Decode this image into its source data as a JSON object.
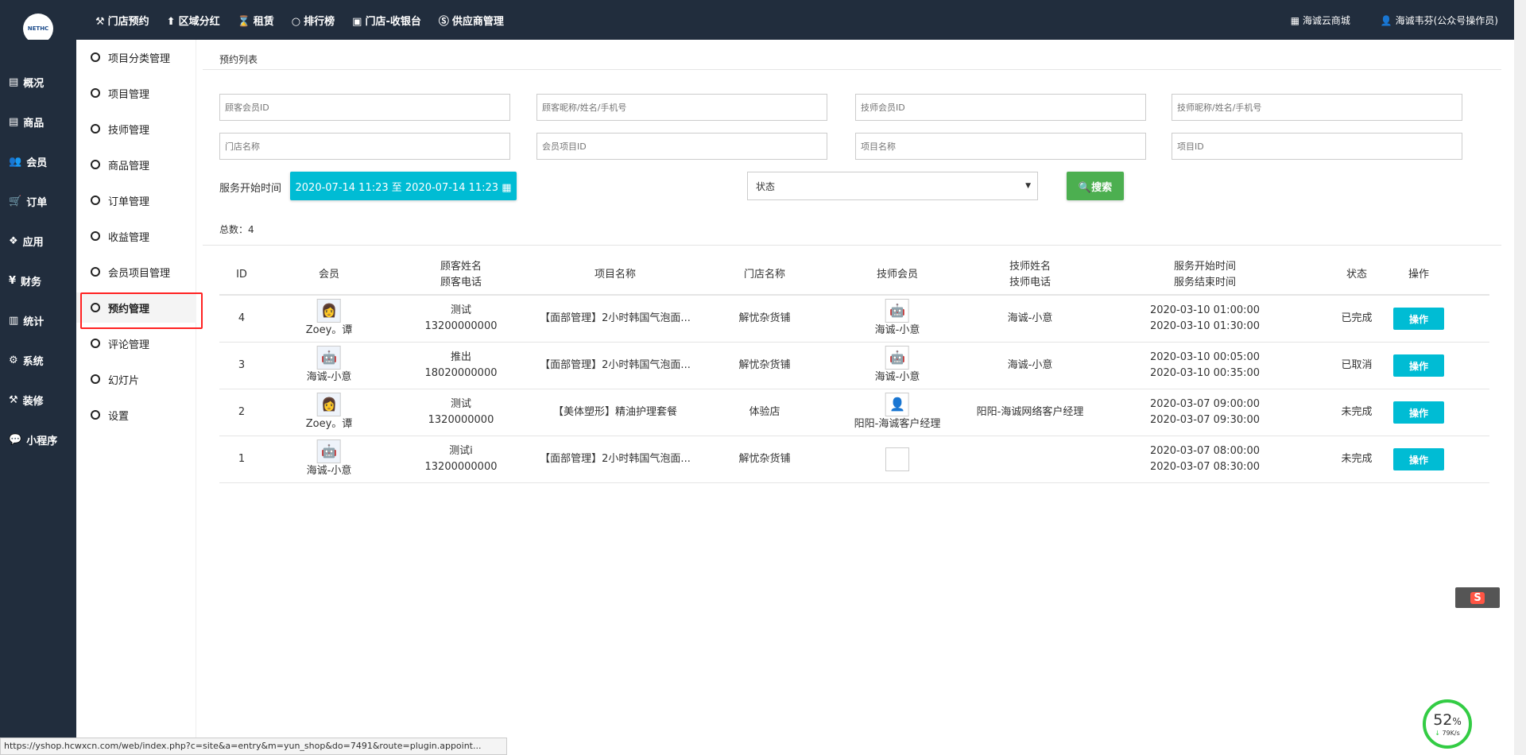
{
  "logo": "NETHC",
  "topnav": [
    {
      "icon": "gavel-icon",
      "glyph": "⚒",
      "label": "门店预约"
    },
    {
      "icon": "pin-icon",
      "glyph": "⬆",
      "label": "区域分红"
    },
    {
      "icon": "hourglass-icon",
      "glyph": "⌛",
      "label": "租赁"
    },
    {
      "icon": "circle-icon",
      "glyph": "○",
      "label": "排行榜"
    },
    {
      "icon": "cash-icon",
      "glyph": "▣",
      "label": "门店-收银台"
    },
    {
      "icon": "skype-icon",
      "glyph": "Ⓢ",
      "label": "供应商管理"
    }
  ],
  "topright": {
    "shop": "海诚云商城",
    "user": "海诚韦芬(公众号操作员)"
  },
  "leftnav": [
    {
      "icon": "archive-icon",
      "glyph": "▤",
      "label": "概况"
    },
    {
      "icon": "archive-icon",
      "glyph": "▤",
      "label": "商品"
    },
    {
      "icon": "users-icon",
      "glyph": "👥",
      "label": "会员"
    },
    {
      "icon": "cart-icon",
      "glyph": "🛒",
      "label": "订单"
    },
    {
      "icon": "cubes-icon",
      "glyph": "❖",
      "label": "应用"
    },
    {
      "icon": "yen-icon",
      "glyph": "¥",
      "label": "财务"
    },
    {
      "icon": "bar-chart-icon",
      "glyph": "▥",
      "label": "统计"
    },
    {
      "icon": "gears-icon",
      "glyph": "⚙",
      "label": "系统"
    },
    {
      "icon": "gavel-icon",
      "glyph": "⚒",
      "label": "装修"
    },
    {
      "icon": "wechat-icon",
      "glyph": "💬",
      "label": "小程序"
    }
  ],
  "subnav": [
    "项目分类管理",
    "项目管理",
    "技师管理",
    "商品管理",
    "订单管理",
    "收益管理",
    "会员项目管理",
    "预约管理",
    "评论管理",
    "幻灯片",
    "设置"
  ],
  "page_title": "预约列表",
  "filters": {
    "placeholders": [
      "顾客会员ID",
      "顾客昵称/姓名/手机号",
      "技师会员ID",
      "技师昵称/姓名/手机号",
      "门店名称",
      "会员项目ID",
      "项目名称",
      "项目ID"
    ],
    "time_label": "服务开始时间",
    "date_range": "2020-07-14 11:23 至 2020-07-14 11:23",
    "status_placeholder": "状态",
    "search": "搜索"
  },
  "total": "总数：4",
  "table": {
    "headers": {
      "id": "ID",
      "member": "会员",
      "cust1": "顾客姓名",
      "cust2": "顾客电话",
      "project": "项目名称",
      "store": "门店名称",
      "tech": "技师会员",
      "techn1": "技师姓名",
      "techn2": "技师电话",
      "time1": "服务开始时间",
      "time2": "服务结束时间",
      "status": "状态",
      "op": "操作"
    },
    "rows": [
      {
        "id": "4",
        "member": "Zoey。谭",
        "avatar": "👩",
        "cname": "测试",
        "cphone": "13200000000",
        "project": "【面部管理】2小时韩国气泡面...",
        "store": "解忧杂货铺",
        "tech": "海诚-小意",
        "techav": "🤖",
        "techname": "海诚-小意",
        "start": "2020-03-10 01:00:00",
        "end": "2020-03-10 01:30:00",
        "status": "已完成",
        "op": "操作"
      },
      {
        "id": "3",
        "member": "海诚-小意",
        "avatar": "🤖",
        "cname": "推出",
        "cphone": "18020000000",
        "project": "【面部管理】2小时韩国气泡面...",
        "store": "解忧杂货铺",
        "tech": "海诚-小意",
        "techav": "🤖",
        "techname": "海诚-小意",
        "start": "2020-03-10 00:05:00",
        "end": "2020-03-10 00:35:00",
        "status": "已取消",
        "op": "操作"
      },
      {
        "id": "2",
        "member": "Zoey。谭",
        "avatar": "👩",
        "cname": "测试",
        "cphone": "1320000000",
        "project": "【美体塑形】精油护理套餐",
        "store": "体验店",
        "tech": "阳阳-海诚客户经理",
        "techav": "👤",
        "techname": "阳阳-海诚网络客户经理",
        "start": "2020-03-07 09:00:00",
        "end": "2020-03-07 09:30:00",
        "status": "未完成",
        "op": "操作"
      },
      {
        "id": "1",
        "member": "海诚-小意",
        "avatar": "🤖",
        "cname": "测试i",
        "cphone": "13200000000",
        "project": "【面部管理】2小时韩国气泡面...",
        "store": "解忧杂货铺",
        "tech": "",
        "techav": "",
        "techname": "",
        "start": "2020-03-07 08:00:00",
        "end": "2020-03-07 08:30:00",
        "status": "未完成",
        "op": "操作"
      }
    ]
  },
  "statusbar": "https://yshop.hcwxcn.com/web/index.php?c=site&a=entry&m=yun_shop&do=7491&route=plugin.appoint...",
  "ime": "S",
  "net": {
    "percent": "52",
    "unit": "%",
    "speed": "79K/s"
  }
}
